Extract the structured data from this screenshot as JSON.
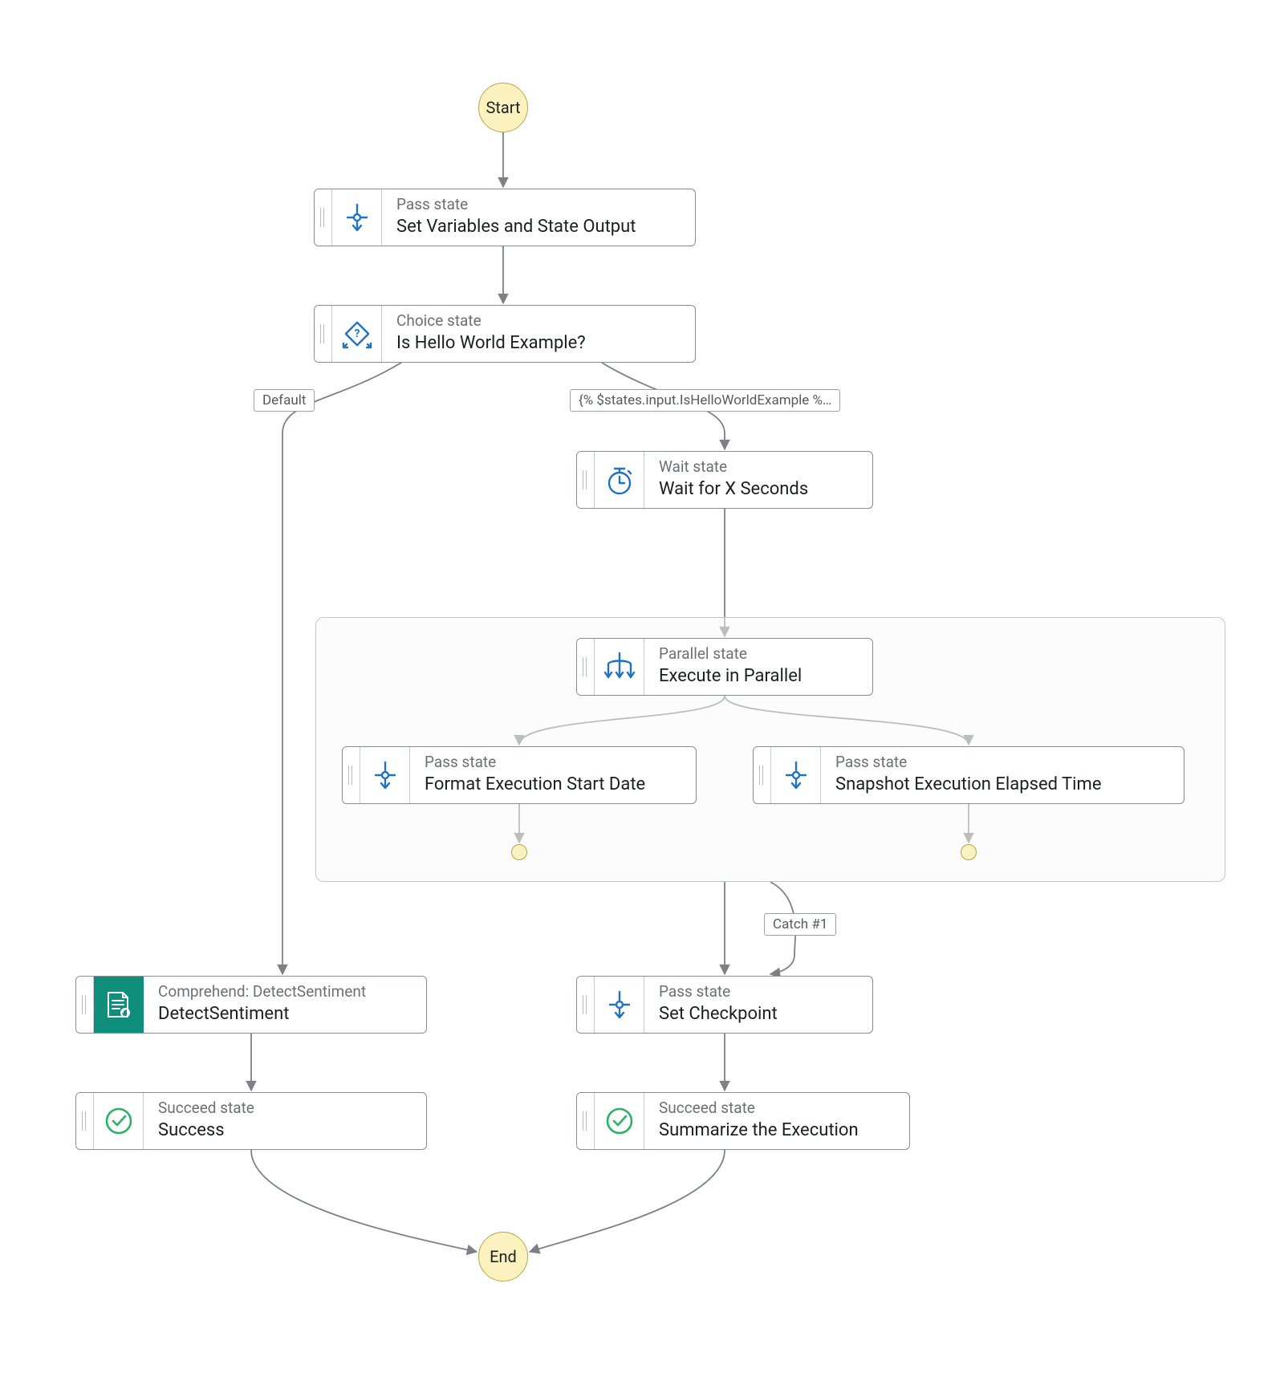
{
  "terminals": {
    "start": "Start",
    "end": "End"
  },
  "nodes": {
    "setvars": {
      "type": "Pass state",
      "name": "Set Variables and State Output"
    },
    "choice": {
      "type": "Choice state",
      "name": "Is Hello World Example?"
    },
    "wait": {
      "type": "Wait state",
      "name": "Wait for X Seconds"
    },
    "parallel": {
      "type": "Parallel state",
      "name": "Execute in Parallel"
    },
    "format": {
      "type": "Pass state",
      "name": "Format Execution Start Date"
    },
    "snapshot": {
      "type": "Pass state",
      "name": "Snapshot Execution Elapsed Time"
    },
    "detect": {
      "type": "Comprehend: DetectSentiment",
      "name": "DetectSentiment"
    },
    "checkpoint": {
      "type": "Pass state",
      "name": "Set Checkpoint"
    },
    "success": {
      "type": "Succeed state",
      "name": "Success"
    },
    "summarize": {
      "type": "Succeed state",
      "name": "Summarize the Execution"
    }
  },
  "edgeLabels": {
    "default": "Default",
    "condition": "{% $states.input.IsHelloWorldExample %…",
    "catch": "Catch #1"
  },
  "colors": {
    "iconBlue": "#1f72c6",
    "successGreen": "#2bb363",
    "serviceTeal": "#0e8e7b",
    "terminalFill": "#fbf2bf"
  }
}
